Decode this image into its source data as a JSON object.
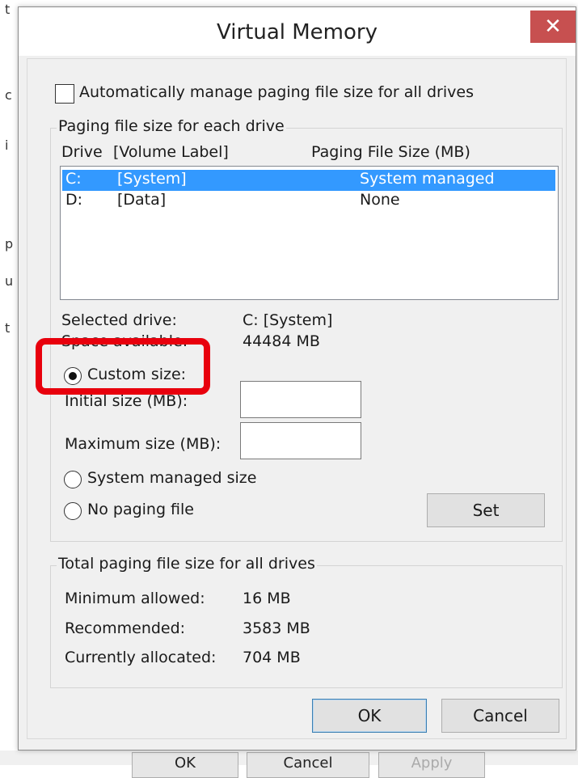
{
  "background": {
    "left_glyphs": [
      "t",
      "c",
      "i",
      "p",
      "u",
      "t"
    ],
    "buttons": [
      "OK",
      "Cancel",
      "Apply"
    ]
  },
  "dialog": {
    "title": "Virtual Memory",
    "close_glyph": "✕",
    "auto_manage_label": "Automatically manage paging file size for all drives",
    "auto_manage_checked": false,
    "paging_group_title": "Paging file size for each drive",
    "col_drive": "Drive",
    "col_volume": "[Volume Label]",
    "col_size": "Paging File Size (MB)",
    "drives": [
      {
        "drive": "C:",
        "label": "[System]",
        "size": "System managed",
        "selected": true
      },
      {
        "drive": "D:",
        "label": "[Data]",
        "size": "None",
        "selected": false
      }
    ],
    "selected_drive_label": "Selected drive:",
    "selected_drive_value": "C:  [System]",
    "space_available_label": "Space available:",
    "space_available_value": "44484 MB",
    "custom_size_label": "Custom size:",
    "initial_size_label": "Initial size (MB):",
    "initial_size_value": "",
    "maximum_size_label": "Maximum size (MB):",
    "maximum_size_value": "",
    "system_managed_label": "System managed size",
    "no_paging_label": "No paging file",
    "selected_option": "custom",
    "set_button": "Set",
    "total_group_title": "Total paging file size for all drives",
    "minimum_allowed_label": "Minimum allowed:",
    "minimum_allowed_value": "16 MB",
    "recommended_label": "Recommended:",
    "recommended_value": "3583 MB",
    "currently_allocated_label": "Currently allocated:",
    "currently_allocated_value": "704 MB",
    "ok_button": "OK",
    "cancel_button": "Cancel"
  },
  "colors": {
    "selection": "#3399ff",
    "close_button": "#c75050",
    "annotation": "#e8000d"
  }
}
